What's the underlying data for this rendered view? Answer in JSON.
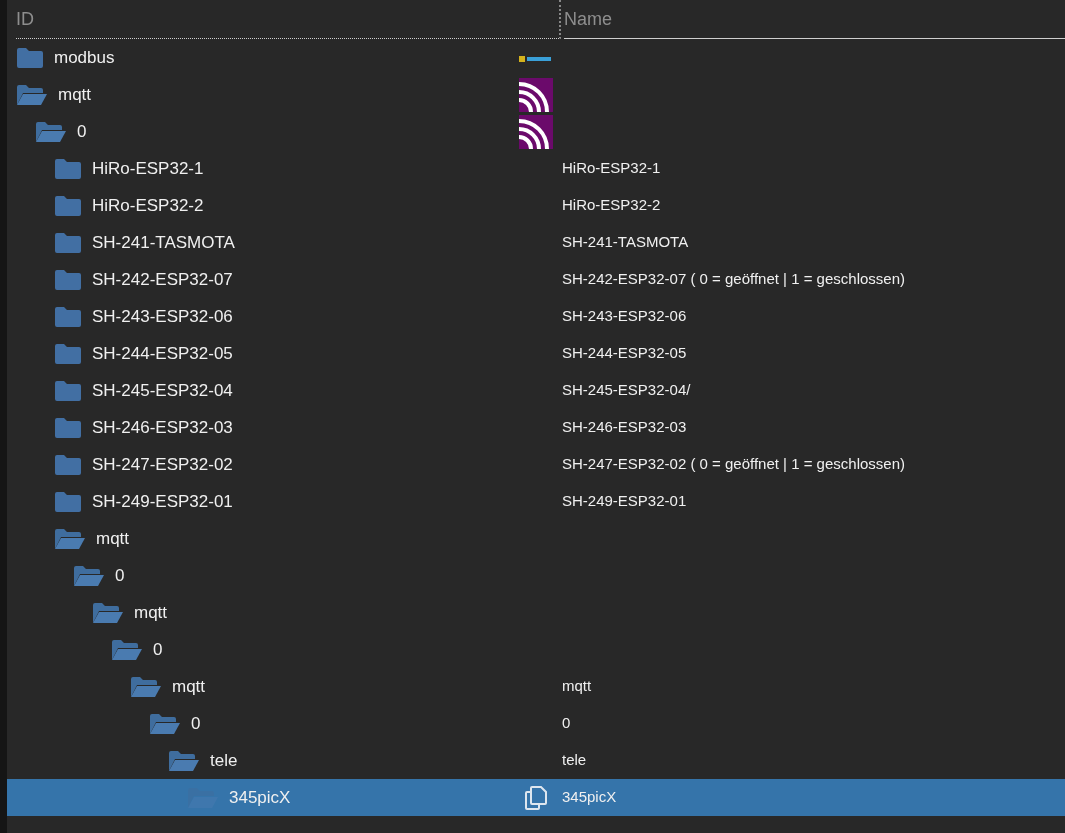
{
  "columns": [
    {
      "label": "ID"
    },
    {
      "label": "Name"
    }
  ],
  "tree": [
    {
      "id": "modbus",
      "expanded": false,
      "selected": false,
      "kind": "adapter"
    },
    {
      "id": "mqtt",
      "expanded": true,
      "selected": false,
      "kind": "broadcast",
      "children": [
        {
          "id": "0",
          "expanded": true,
          "selected": false,
          "kind": "broadcast",
          "children": [
            {
              "id": "HiRo-ESP32-1",
              "name": "HiRo-ESP32-1",
              "expanded": false,
              "selected": false
            },
            {
              "id": "HiRo-ESP32-2",
              "name": "HiRo-ESP32-2",
              "expanded": false,
              "selected": false
            },
            {
              "id": "SH-241-TASMOTA",
              "name": "SH-241-TASMOTA",
              "expanded": false,
              "selected": false
            },
            {
              "id": "SH-242-ESP32-07",
              "name": "SH-242-ESP32-07 ( 0 = geöffnet | 1 = geschlossen)",
              "expanded": false,
              "selected": false
            },
            {
              "id": "SH-243-ESP32-06",
              "name": "SH-243-ESP32-06",
              "expanded": false,
              "selected": false
            },
            {
              "id": "SH-244-ESP32-05",
              "name": "SH-244-ESP32-05",
              "expanded": false,
              "selected": false
            },
            {
              "id": "SH-245-ESP32-04",
              "name": "SH-245-ESP32-04/",
              "expanded": false,
              "selected": false
            },
            {
              "id": "SH-246-ESP32-03",
              "name": "SH-246-ESP32-03",
              "expanded": false,
              "selected": false
            },
            {
              "id": "SH-247-ESP32-02",
              "name": "SH-247-ESP32-02 ( 0 = geöffnet | 1 = geschlossen)",
              "expanded": false,
              "selected": false
            },
            {
              "id": "SH-249-ESP32-01",
              "name": "SH-249-ESP32-01",
              "expanded": false,
              "selected": false
            },
            {
              "id": "mqtt",
              "expanded": true,
              "selected": false,
              "children": [
                {
                  "id": "0",
                  "expanded": true,
                  "selected": false,
                  "children": [
                    {
                      "id": "mqtt",
                      "expanded": true,
                      "selected": false,
                      "children": [
                        {
                          "id": "0",
                          "expanded": true,
                          "selected": false,
                          "children": [
                            {
                              "id": "mqtt",
                              "name": "mqtt",
                              "expanded": true,
                              "selected": false,
                              "children": [
                                {
                                  "id": "0",
                                  "name": "0",
                                  "expanded": true,
                                  "selected": false,
                                  "children": [
                                    {
                                      "id": "tele",
                                      "name": "tele",
                                      "expanded": true,
                                      "selected": false,
                                      "children": [
                                        {
                                          "id": "345picX",
                                          "name": "345picX",
                                          "expanded": true,
                                          "selected": true,
                                          "kind": "copy"
                                        }
                                      ]
                                    }
                                  ]
                                }
                              ]
                            }
                          ]
                        }
                      ]
                    }
                  ]
                }
              ]
            }
          ]
        }
      ]
    }
  ]
}
